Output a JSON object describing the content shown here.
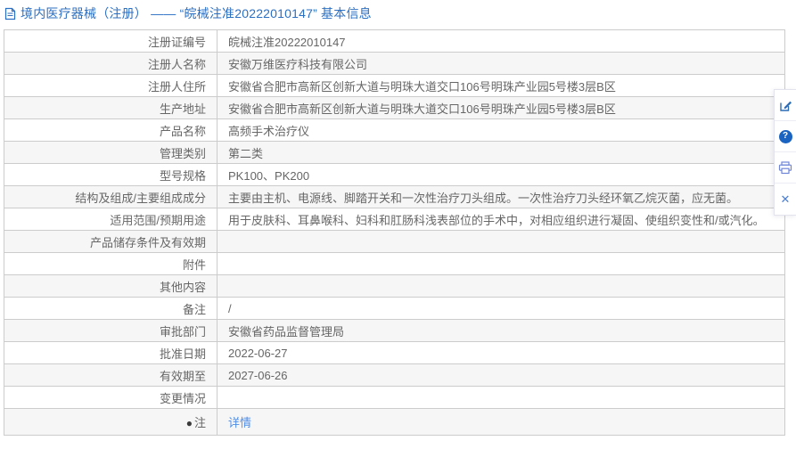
{
  "page": {
    "title": "境内医疗器械（注册） —— “皖械注准20222010147” 基本信息"
  },
  "table": {
    "rows": [
      {
        "label": "注册证编号",
        "value": "皖械注准20222010147"
      },
      {
        "label": "注册人名称",
        "value": "安徽万维医疗科技有限公司"
      },
      {
        "label": "注册人住所",
        "value": "安徽省合肥市高新区创新大道与明珠大道交口106号明珠产业园5号楼3层B区"
      },
      {
        "label": "生产地址",
        "value": "安徽省合肥市高新区创新大道与明珠大道交口106号明珠产业园5号楼3层B区"
      },
      {
        "label": "产品名称",
        "value": "高频手术治疗仪"
      },
      {
        "label": "管理类别",
        "value": "第二类"
      },
      {
        "label": "型号规格",
        "value": "PK100、PK200"
      },
      {
        "label": "结构及组成/主要组成成分",
        "value": "主要由主机、电源线、脚踏开关和一次性治疗刀头组成。一次性治疗刀头经环氧乙烷灭菌，应无菌。"
      },
      {
        "label": "适用范围/预期用途",
        "value": "用于皮肤科、耳鼻喉科、妇科和肛肠科浅表部位的手术中，对相应组织进行凝固、使组织变性和/或汽化。"
      },
      {
        "label": "产品储存条件及有效期",
        "value": ""
      },
      {
        "label": "附件",
        "value": ""
      },
      {
        "label": "其他内容",
        "value": ""
      },
      {
        "label": "备注",
        "value": "/"
      },
      {
        "label": "审批部门",
        "value": "安徽省药品监督管理局"
      },
      {
        "label": "批准日期",
        "value": "2022-06-27"
      },
      {
        "label": "有效期至",
        "value": "2027-06-26"
      },
      {
        "label": "变更情况",
        "value": ""
      },
      {
        "label": "注",
        "label_prefix": "●",
        "value": "详情",
        "link": true
      }
    ]
  },
  "toolbar": {
    "items": [
      {
        "name": "edit-icon"
      },
      {
        "name": "help-icon",
        "glyph": "?"
      },
      {
        "name": "print-icon"
      },
      {
        "name": "close-icon",
        "glyph": "✕"
      }
    ]
  },
  "colors": {
    "title_blue": "#2b6fc2",
    "link_blue": "#4e8ee8",
    "row_alt_bg": "#f6f6f7",
    "table_border": "#cccccc",
    "text_gray": "#666666",
    "toolbar_edit_blue": "#2d6cb5",
    "toolbar_help_blue": "#1a63c0",
    "toolbar_print_blue": "#6f86d8",
    "toolbar_close_blue": "#4a7fd4"
  }
}
